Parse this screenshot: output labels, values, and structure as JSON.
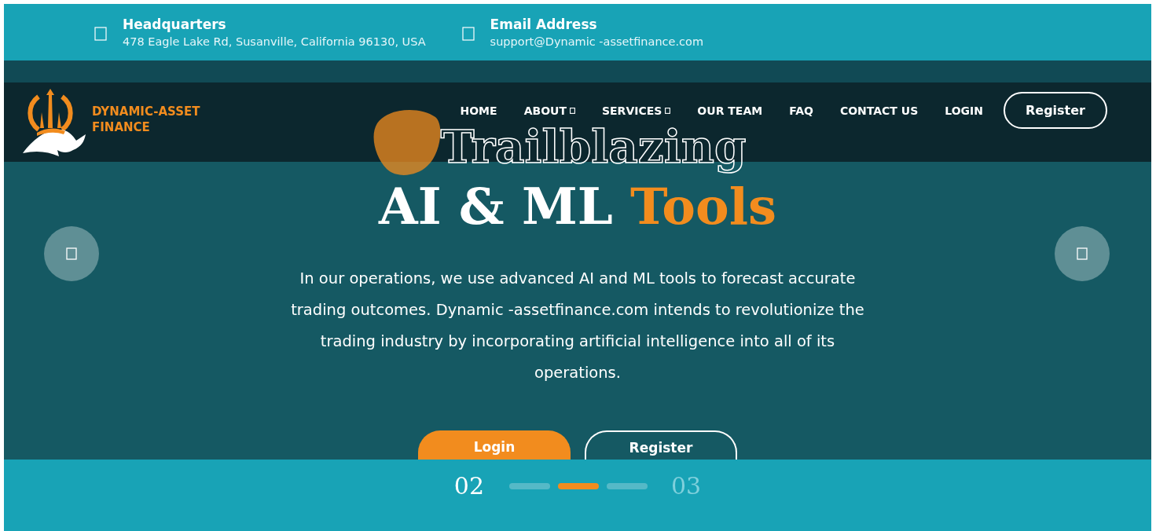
{
  "topbar": {
    "items": [
      {
        "title": "Headquarters",
        "text": "478 Eagle Lake Rd, Susanville, California 96130, USA"
      },
      {
        "title": "Email Address",
        "text": "support@Dynamic -assetfinance.com"
      }
    ]
  },
  "logo": {
    "lines": [
      "DYNAMIC-ASSET",
      "FINANCE"
    ]
  },
  "nav": {
    "items": [
      {
        "label": "HOME",
        "dropdown": false
      },
      {
        "label": "ABOUT",
        "dropdown": true
      },
      {
        "label": "SERVICES",
        "dropdown": true
      },
      {
        "label": "OUR TEAM",
        "dropdown": false
      },
      {
        "label": "FAQ",
        "dropdown": false
      },
      {
        "label": "CONTACT US",
        "dropdown": false
      },
      {
        "label": "LOGIN",
        "dropdown": false
      }
    ],
    "button": "Register"
  },
  "hero": {
    "kicker": "Trailblazing",
    "title": "AI & ML",
    "title_accent": "Tools",
    "text": "In our operations, we use advanced AI and ML tools to forecast accurate trading outcomes. Dynamic -assetfinance.com intends to revolutionize the trading industry by incorporating artificial intelligence into all of its operations.",
    "buttons": [
      {
        "label": "Login",
        "kind": "primary"
      },
      {
        "label": "Register",
        "kind": "outline"
      }
    ]
  },
  "pager": {
    "current": "02",
    "next": "03",
    "dots": [
      {
        "selected": false
      },
      {
        "selected": true
      },
      {
        "selected": false
      }
    ]
  }
}
